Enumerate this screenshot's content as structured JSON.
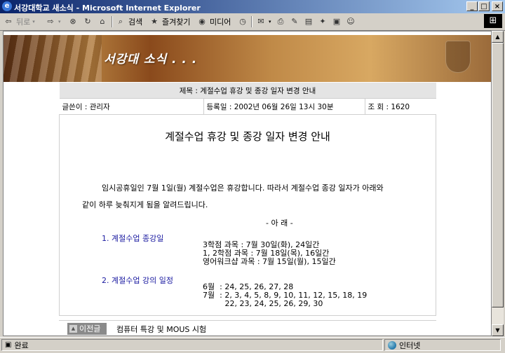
{
  "window": {
    "title": "서강대학교 새소식 - Microsoft Internet Explorer"
  },
  "toolbar": {
    "back_label": "뒤로",
    "search_label": "검색",
    "favorites_label": "즐겨찾기",
    "media_label": "미디어"
  },
  "banner": {
    "brand": "서강대 소식 . . ."
  },
  "article": {
    "subject": "제목 : 계절수업 휴강 및 종강 일자 변경 안내",
    "author": "글쓴이 : 관리자",
    "date": "등록일 : 2002년 06월 26일 13시 30분",
    "views": "조 회 : 1620",
    "title": "계절수업 휴강 및 종강 일자 변경 안내",
    "para1": "임시공휴일인 7월 1일(월) 계절수업은 휴강합니다. 따라서 계절수업 종강 일자가 아래와",
    "para2": "같이 하루 늦춰지게 됨을 알려드립니다.",
    "notice": "- 아    래 -",
    "section1_heading": "1. 계절수업 종강일",
    "section1_lines": [
      "3학점 과목 : 7월 30일(화), 24일간",
      "1, 2학점 과목 : 7월 18일(목), 16일간",
      "영어워크샵 과목 : 7월 15일(월), 15일간"
    ],
    "section2_heading": "2. 계절수업 강의 일정",
    "section2_lines": [
      "6월  : 24, 25, 26, 27, 28",
      "7월  : 2, 3, 4, 5, 8, 9, 10, 11, 12, 15, 18, 19",
      "         22, 23, 24, 25, 26, 29, 30"
    ]
  },
  "prev": {
    "button_label": "이전글",
    "title": "컴퓨터 특강 및 MOUS 시험"
  },
  "status": {
    "left": "완료",
    "zone": "인터넷"
  }
}
